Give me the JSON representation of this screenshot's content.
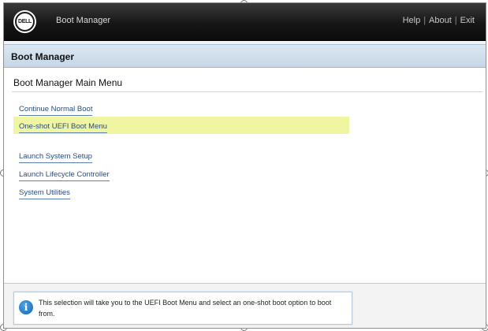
{
  "header": {
    "logo_text": "DELL",
    "app_title": "Boot Manager",
    "links": [
      "Help",
      "About",
      "Exit"
    ],
    "separator": "|"
  },
  "section": {
    "title": "Boot Manager"
  },
  "menu": {
    "heading": "Boot Manager Main Menu",
    "items": [
      {
        "label": "Continue Normal Boot",
        "selected": false
      },
      {
        "label": "One-shot UEFI Boot Menu",
        "selected": true
      },
      {
        "label": "Launch System Setup",
        "selected": false
      },
      {
        "label": "Launch Lifecycle Controller",
        "selected": false
      },
      {
        "label": "System Utilities",
        "selected": false
      }
    ]
  },
  "help": {
    "text": "This selection will take you to the UEFI Boot Menu and select an one-shot boot option to boot from."
  },
  "colors": {
    "highlight": "#eff5a1",
    "link": "#2b4c7a",
    "section_bar": "#c6d6e6",
    "info_icon": "#1466b3"
  }
}
